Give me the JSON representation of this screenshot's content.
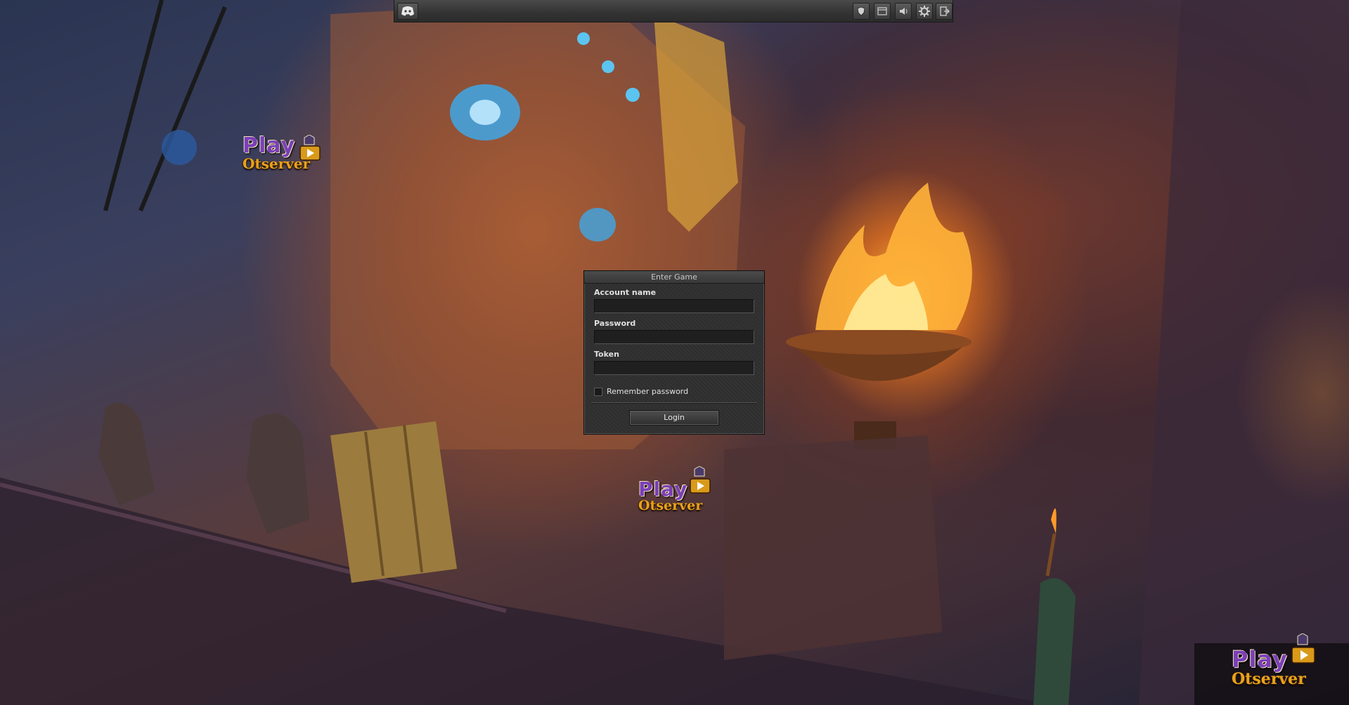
{
  "toolbar": {
    "discord_icon": "discord-icon",
    "icons": [
      "shield-icon",
      "window-icon",
      "speaker-icon",
      "gear-icon",
      "exit-icon"
    ]
  },
  "login": {
    "title": "Enter Game",
    "account_label": "Account name",
    "account_value": "",
    "password_label": "Password",
    "password_value": "",
    "token_label": "Token",
    "token_value": "",
    "remember_label": "Remember password",
    "remember_checked": false,
    "login_button": "Login"
  },
  "watermark": {
    "play": "Play",
    "brand": "Otserver"
  },
  "colors": {
    "panel": "#2f2f2f",
    "watermark_play": "#7b3fb8",
    "watermark_brand": "#e8a21c"
  }
}
